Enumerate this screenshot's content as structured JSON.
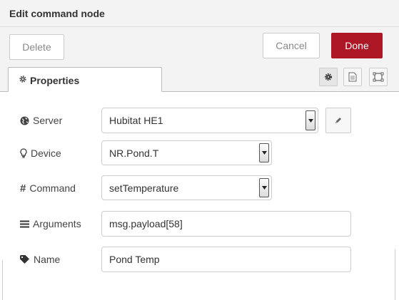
{
  "header": {
    "title": "Edit command node"
  },
  "toolbar": {
    "delete_label": "Delete",
    "cancel_label": "Cancel",
    "done_label": "Done"
  },
  "tabs": {
    "properties_label": "Properties"
  },
  "form": {
    "server": {
      "label": "Server",
      "value": "Hubitat HE1",
      "icon": "globe-icon"
    },
    "device": {
      "label": "Device",
      "value": "NR.Pond.T",
      "icon": "lightbulb-icon"
    },
    "command": {
      "label": "Command",
      "value": "setTemperature",
      "icon": "hash-icon"
    },
    "arguments": {
      "label": "Arguments",
      "value": "msg.payload[58]",
      "icon": "list-icon"
    },
    "name": {
      "label": "Name",
      "value": "Pond Temp",
      "icon": "tag-icon"
    }
  },
  "colors": {
    "accent": "#ad1625",
    "panel_bg": "#f3f3f3",
    "border": "#cccccc"
  }
}
